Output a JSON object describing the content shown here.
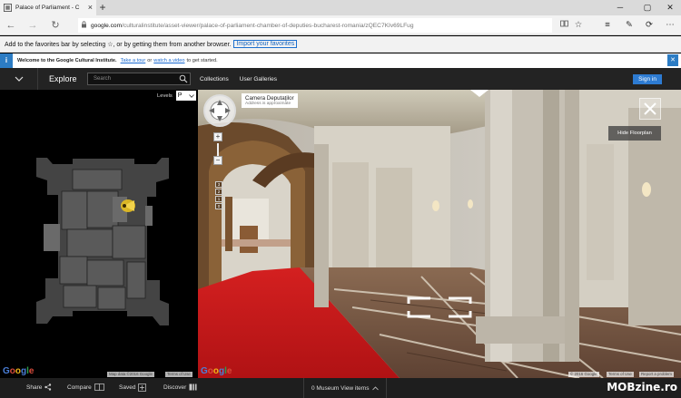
{
  "browser": {
    "tab_title": "Palace of Parliament - C",
    "url_host": "google.com",
    "url_path": "/culturalinstitute/asset-viewer/palace-of-parliament-chamber-of-deputies-bucharest-romania/zQEC7KIv69LFug",
    "favorites_prompt": "Add to the favorites bar by selecting ☆, or by getting them from another browser.",
    "import_favorites": "Import your favorites"
  },
  "notice": {
    "welcome": "Welcome to the Google Cultural Institute.",
    "take_tour": "Take a tour",
    "or": "or",
    "watch_video": "watch a video",
    "to_get_started": "to get started."
  },
  "header": {
    "explore": "Explore",
    "search_placeholder": "Search",
    "collections": "Collections",
    "user_galleries": "User Galleries",
    "sign_in": "Sign in"
  },
  "floorplan": {
    "levels_label": "Levels",
    "level_value": "P",
    "attribution_map_data": "Map data ©2016 Google",
    "attribution_terms": "Terms of Use"
  },
  "streetview": {
    "location_title": "Camera Deputaţilor",
    "location_subtitle": "Address is approximate",
    "hide_floorplan": "Hide Floorplan",
    "floor_levels": [
      "3",
      "2",
      "1",
      "0"
    ],
    "attribution_copy": "© 2016 Google",
    "attribution_terms": "Terms of Use",
    "report_problem": "Report a problem"
  },
  "bottom_bar": {
    "share": "Share",
    "compare": "Compare",
    "saved": "Saved",
    "discover": "Discover",
    "museum_view": "0 Museum View items"
  },
  "watermark": "MOBzine.ro",
  "colors": {
    "accent_blue": "#2d7bd2",
    "header_bg": "#232323",
    "carpet_red": "#c8181c"
  }
}
